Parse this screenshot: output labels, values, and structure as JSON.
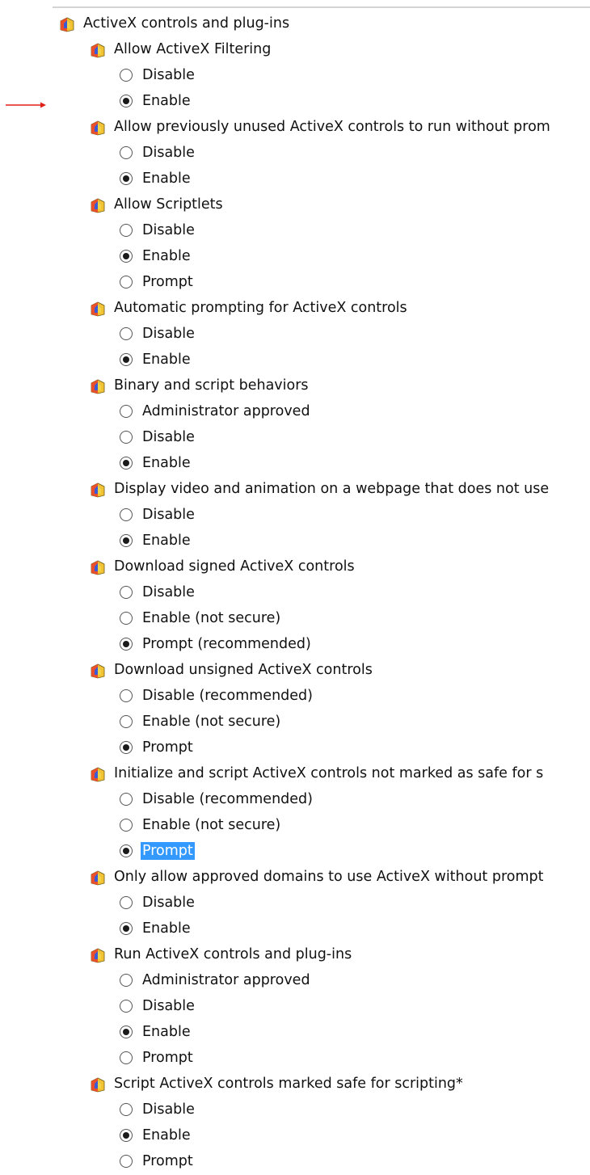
{
  "tree": {
    "root": "ActiveX controls and plug-ins",
    "settings": [
      {
        "title": "Allow ActiveX Filtering",
        "options": [
          {
            "label": "Disable",
            "checked": false
          },
          {
            "label": "Enable",
            "checked": true
          }
        ]
      },
      {
        "title": "Allow previously unused ActiveX controls to run without prom",
        "options": [
          {
            "label": "Disable",
            "checked": false
          },
          {
            "label": "Enable",
            "checked": true
          }
        ]
      },
      {
        "title": "Allow Scriptlets",
        "options": [
          {
            "label": "Disable",
            "checked": false
          },
          {
            "label": "Enable",
            "checked": true
          },
          {
            "label": "Prompt",
            "checked": false
          }
        ]
      },
      {
        "title": "Automatic prompting for ActiveX controls",
        "options": [
          {
            "label": "Disable",
            "checked": false
          },
          {
            "label": "Enable",
            "checked": true
          }
        ]
      },
      {
        "title": "Binary and script behaviors",
        "options": [
          {
            "label": "Administrator approved",
            "checked": false
          },
          {
            "label": "Disable",
            "checked": false
          },
          {
            "label": "Enable",
            "checked": true
          }
        ]
      },
      {
        "title": "Display video and animation on a webpage that does not use",
        "options": [
          {
            "label": "Disable",
            "checked": false
          },
          {
            "label": "Enable",
            "checked": true
          }
        ]
      },
      {
        "title": "Download signed ActiveX controls",
        "options": [
          {
            "label": "Disable",
            "checked": false
          },
          {
            "label": "Enable (not secure)",
            "checked": false
          },
          {
            "label": "Prompt (recommended)",
            "checked": true
          }
        ]
      },
      {
        "title": "Download unsigned ActiveX controls",
        "options": [
          {
            "label": "Disable (recommended)",
            "checked": false
          },
          {
            "label": "Enable (not secure)",
            "checked": false
          },
          {
            "label": "Prompt",
            "checked": true
          }
        ]
      },
      {
        "title": "Initialize and script ActiveX controls not marked as safe for s",
        "options": [
          {
            "label": "Disable (recommended)",
            "checked": false
          },
          {
            "label": "Enable (not secure)",
            "checked": false
          },
          {
            "label": "Prompt",
            "checked": true,
            "selected": true
          }
        ]
      },
      {
        "title": "Only allow approved domains to use ActiveX without prompt",
        "options": [
          {
            "label": "Disable",
            "checked": false
          },
          {
            "label": "Enable",
            "checked": true
          }
        ]
      },
      {
        "title": "Run ActiveX controls and plug-ins",
        "options": [
          {
            "label": "Administrator approved",
            "checked": false
          },
          {
            "label": "Disable",
            "checked": false
          },
          {
            "label": "Enable",
            "checked": true
          },
          {
            "label": "Prompt",
            "checked": false
          }
        ]
      },
      {
        "title": "Script ActiveX controls marked safe for scripting*",
        "options": [
          {
            "label": "Disable",
            "checked": false
          },
          {
            "label": "Enable",
            "checked": true
          },
          {
            "label": "Prompt",
            "checked": false
          }
        ]
      }
    ]
  },
  "colors": {
    "selection": "#3399ff",
    "arrow": "#e0201a"
  },
  "icons": {
    "setting": "security-settings-icon",
    "marker": "red-arrow-icon"
  }
}
